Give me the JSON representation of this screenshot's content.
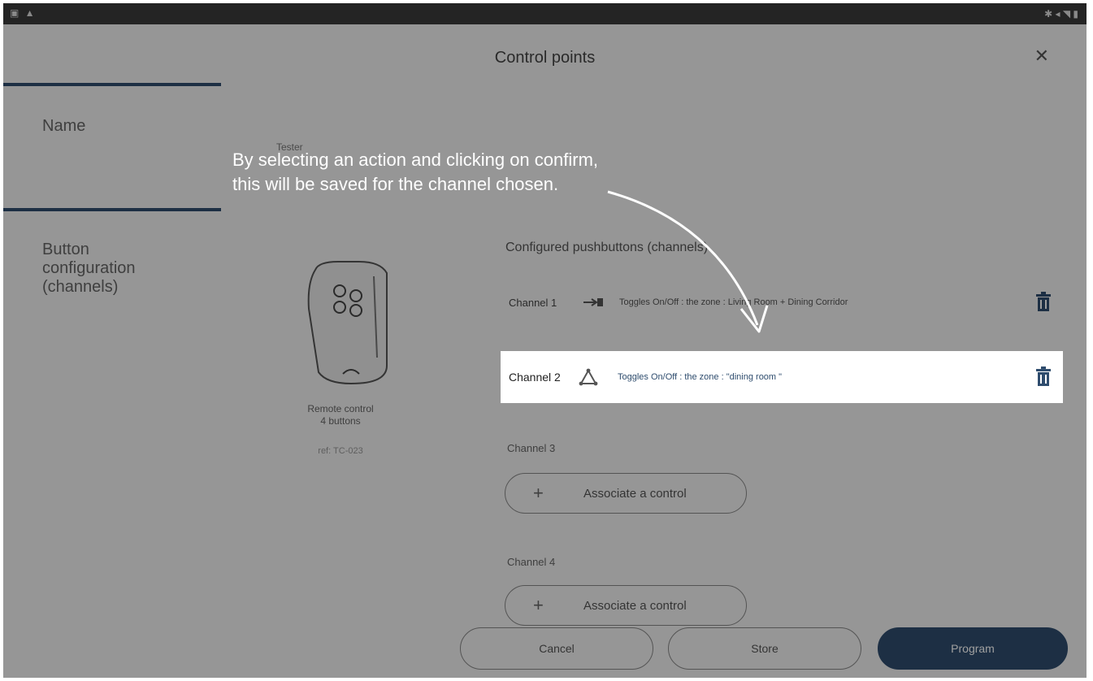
{
  "dialog": {
    "title": "Control points",
    "close_icon": "close-icon"
  },
  "sidebar": {
    "items": [
      {
        "label": "Name"
      },
      {
        "label": "Button\nconfiguration\n(channels)"
      }
    ],
    "accent": "#2f4d6e"
  },
  "name_field": {
    "sub_text": "Tester"
  },
  "remote": {
    "label": "Remote control\n4 buttons",
    "ref": "ref: TC-023"
  },
  "configured": {
    "title": "Configured pushbuttons (channels)",
    "channels": [
      {
        "name": "Channel 1",
        "icon": "shutter-icon",
        "desc": "Toggles On/Off : the zone : Living Room + Dining Corridor"
      },
      {
        "name": "Channel 2",
        "icon": "zone-triangle-icon",
        "desc": "Toggles On/Off : the zone : \"dining room \""
      },
      {
        "name": "Channel 3",
        "action": "Associate a control"
      },
      {
        "name": "Channel 4",
        "action": "Associate a control"
      }
    ]
  },
  "buttons": {
    "cancel": "Cancel",
    "store": "Store",
    "program": "Program"
  },
  "annotation": {
    "text": "By selecting an action and clicking on confirm, this will be saved for the channel chosen."
  }
}
